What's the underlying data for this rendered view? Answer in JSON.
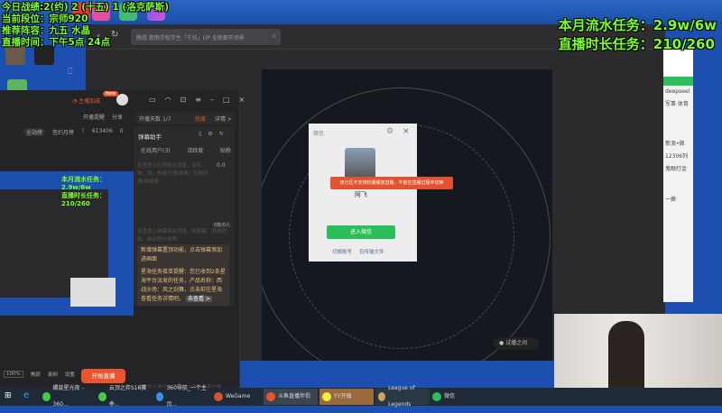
{
  "overlay_left": {
    "lines": [
      "今日战绩:2(约) 2 (十五) 1 (洛克萨斯)",
      "当前段位：宗师920",
      "推荐阵容：九五 水晶",
      "直播时间：下午5点 24点"
    ]
  },
  "overlay_right": {
    "lines": [
      "本月流水任务：2.9w/6w",
      "直播时长任务：210/260"
    ]
  },
  "main_window": {
    "search_placeholder": "晚霞 惹雨学校学生「千玖」UP 全新都市场景",
    "mini_status": "试播之间"
  },
  "left_panel": {
    "promo_label": "主播加成",
    "promo_badge": "New",
    "actions": [
      "开播提醒",
      "分享"
    ],
    "stats": {
      "region": "全站榜",
      "fans_label": "签约月榜",
      "fans_value": "7",
      "hot": "613406",
      "likes": "0"
    },
    "days_label": "开播天数",
    "days_value": "1/7",
    "heat_label": "热度",
    "detail_label": "详情 >",
    "danmu_title": "弹幕助手",
    "tabs": [
      "在线用户(3)",
      "活跃度",
      "贴粉"
    ],
    "hint1": "这里显示礼物相关消息，如礼物、钱、贵族开通/续费、钻粉开通/续费等",
    "score": "0.0",
    "count_badge": "0条/0人",
    "hint2": "这里显示弹幕相关消息，如弹幕、系统消息、粉丝牌升级等",
    "note1": "新增弹幕置顶功能，点击弹幕添加进画面",
    "note2": "星海任务接单提醒：您已收到2条星海平台派发的任务，产品名称：西战沙场：风之剑舞，点击前往星海查看任务详情吧。",
    "note2_link": "去查看 >",
    "hint3": "这里显示谁关注了你，以及进场用户等",
    "zoom": "100%",
    "tools": [
      "美颜",
      "录制",
      "设置"
    ],
    "start_button": "开始直播",
    "preview_overlay": [
      "本月流水任务：2.9w/6w",
      "直播时长任务：210/260"
    ]
  },
  "wechat": {
    "title": "微信",
    "name": "阿飞",
    "toast": "该分区不支持轮播播放直播，不能在直播过程中切换",
    "login_button": "进入微信",
    "switch_account": "切换账号",
    "file_only": "仅传输文件"
  },
  "browser": {
    "snippets": [
      "deepseel",
      "军事 体育",
      "新浪•微",
      "12306列",
      "鬼眼打金",
      "一换"
    ]
  },
  "taskbar": {
    "items": [
      "螺旋星光夜 - 360...",
      "云顶之弈S16赛季...",
      "360导航_一个主页...",
      "WeGame",
      "斗鱼直播伴侣",
      "YY开播",
      "League of Legends",
      "微信"
    ]
  },
  "colors": {
    "accent": "#e8552f",
    "overlay": "#7cff2a",
    "wechat_green": "#2bbf5c"
  }
}
